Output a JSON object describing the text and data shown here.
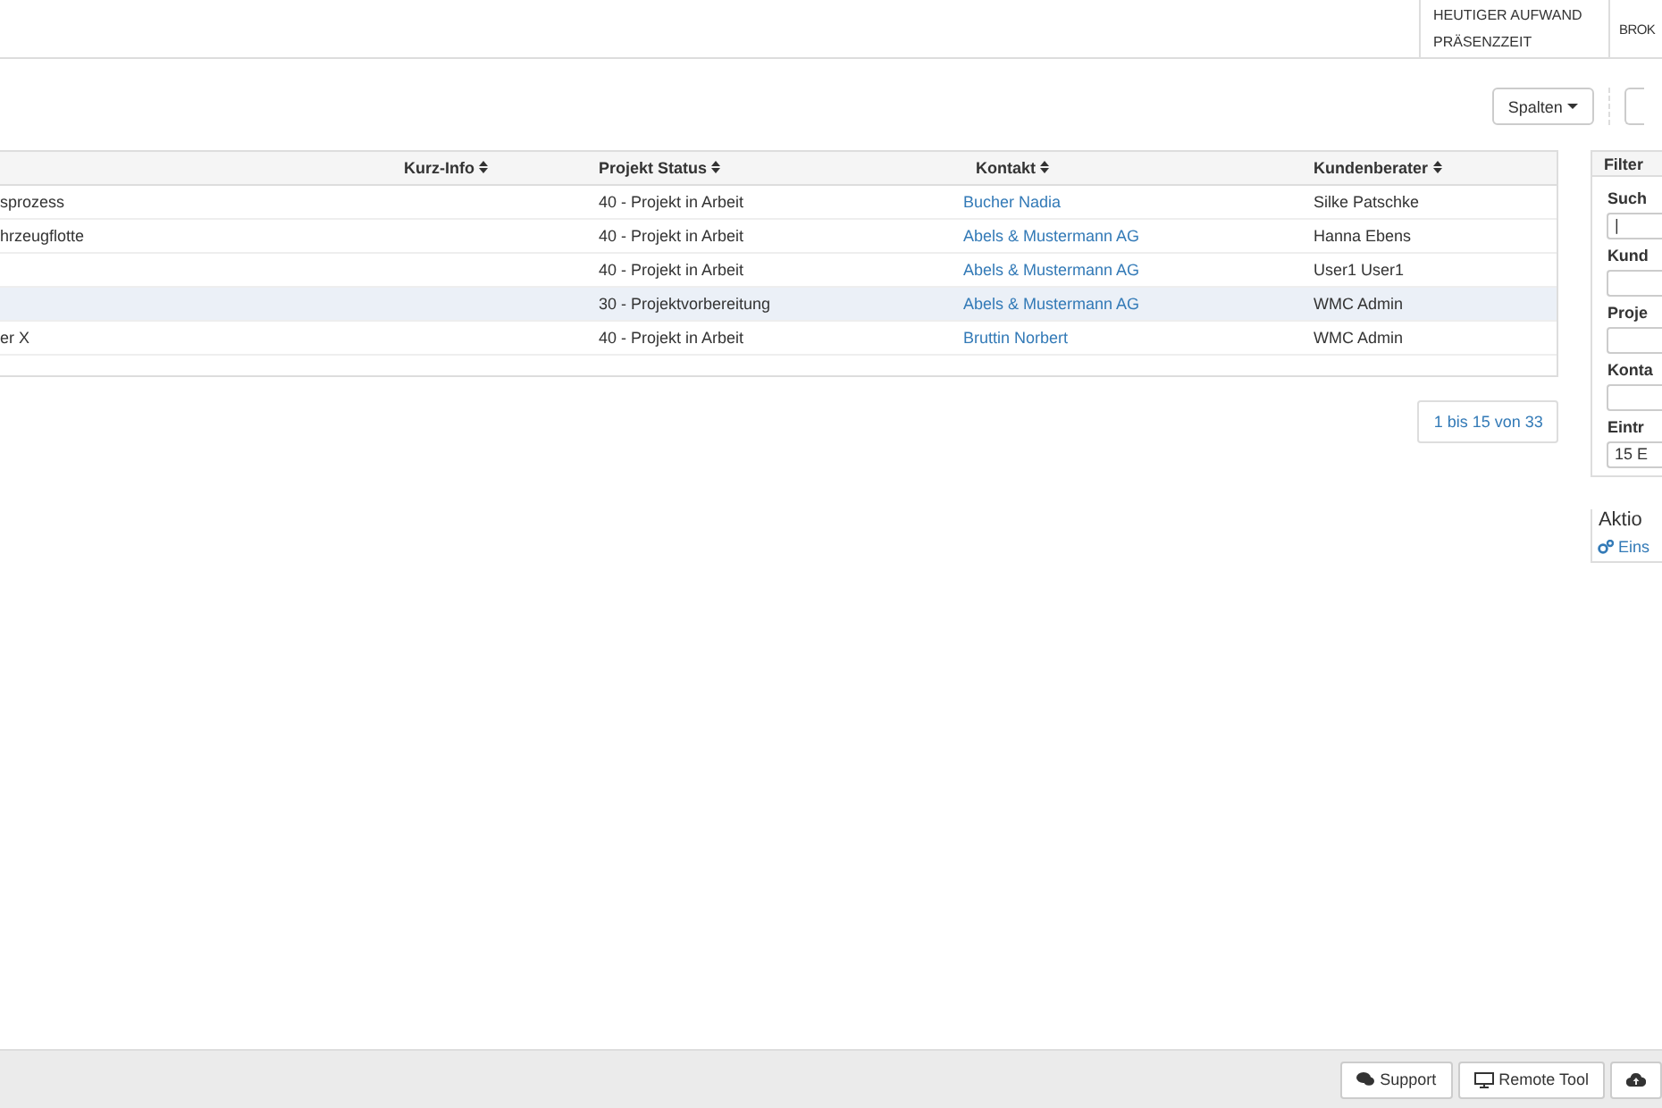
{
  "header": {
    "cells": [
      {
        "lines": [
          "HEUTIGER AUFWAND",
          "PRÄSENZZEIT"
        ]
      },
      {
        "lines": [
          "BROK"
        ]
      }
    ]
  },
  "toolbar": {
    "buttons": [
      {
        "label": "Spalten",
        "kind": "dropdown"
      },
      {
        "kind": "partial"
      }
    ]
  },
  "table": {
    "columns": [
      {},
      {
        "label": "Kurz-Info",
        "sortable": true
      },
      {
        "label": "Projekt Status",
        "sortable": true
      },
      {
        "label": "Kontakt",
        "sortable": true
      },
      {
        "label": "Kundenberater",
        "sortable": true
      }
    ],
    "rows": [
      {
        "selected": false,
        "cells": [
          "sprozess",
          null,
          "40 - Projekt in Arbeit",
          "Bucher Nadia",
          "Silke Patschke"
        ]
      },
      {
        "selected": false,
        "cells": [
          "hrzeugflotte",
          null,
          "40 - Projekt in Arbeit",
          "Abels & Mustermann AG",
          "Hanna Ebens"
        ]
      },
      {
        "selected": false,
        "cells": [
          null,
          null,
          "40 - Projekt in Arbeit",
          "Abels & Mustermann AG",
          "User1 User1"
        ]
      },
      {
        "selected": true,
        "cells": [
          null,
          null,
          "30 - Projektvorbereitung",
          "Abels & Mustermann AG",
          "WMC Admin"
        ]
      },
      {
        "selected": false,
        "cells": [
          "er X",
          null,
          "40 - Projekt in Arbeit",
          "Bruttin Norbert",
          "WMC Admin"
        ]
      }
    ]
  },
  "pagination": "1 bis 15 von 33",
  "filter": {
    "title": "Filter",
    "fields": [
      {
        "label": "Such",
        "value": "|"
      },
      {
        "label": "Kund"
      },
      {
        "label": "Proje"
      },
      {
        "label": "Konta"
      },
      {
        "label": "Eintr",
        "value": "15 E"
      }
    ]
  },
  "actions": {
    "title": "Aktio",
    "link": "Eins"
  },
  "footer": {
    "buttons": [
      {
        "label": "Support",
        "kind": "support"
      },
      {
        "label": "Remote Tool",
        "kind": "remote"
      },
      {
        "kind": "upload"
      }
    ]
  }
}
